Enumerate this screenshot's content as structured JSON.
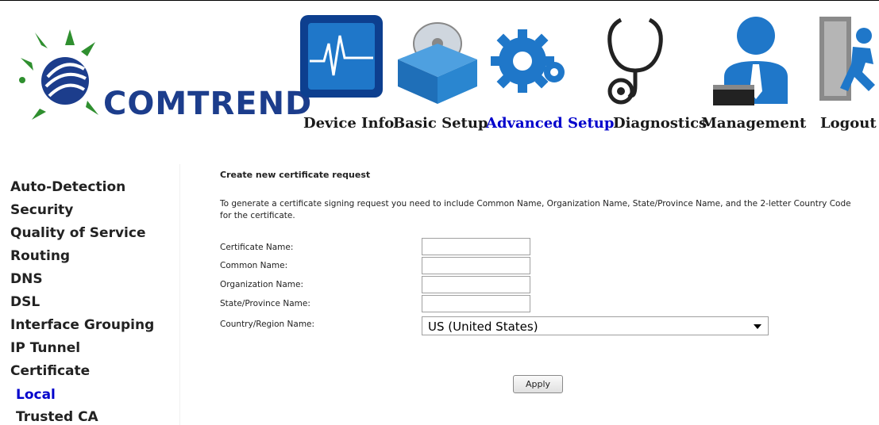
{
  "brand": {
    "logo_text": "COMTREND"
  },
  "nav": {
    "items": [
      {
        "label": "Device Info",
        "icon": "monitor-chart-icon"
      },
      {
        "label": "Basic Setup",
        "icon": "disc-box-icon"
      },
      {
        "label": "Advanced Setup",
        "icon": "gears-icon",
        "active": true
      },
      {
        "label": "Diagnostics",
        "icon": "stethoscope-icon"
      },
      {
        "label": "Management",
        "icon": "user-admin-icon"
      },
      {
        "label": "Logout",
        "icon": "exit-runner-icon"
      }
    ]
  },
  "sidebar": {
    "items": [
      {
        "label": "Auto-Detection"
      },
      {
        "label": "Security"
      },
      {
        "label": "Quality of Service"
      },
      {
        "label": "Routing"
      },
      {
        "label": "DNS"
      },
      {
        "label": "DSL"
      },
      {
        "label": "Interface Grouping"
      },
      {
        "label": "IP Tunnel"
      },
      {
        "label": "Certificate"
      },
      {
        "label": "Local",
        "active": true
      },
      {
        "label": "Trusted CA"
      }
    ]
  },
  "form": {
    "title": "Create new certificate request",
    "description": "To generate a certificate signing request you need to include Common Name, Organization Name, State/Province Name, and the 2-letter Country Code for the certificate.",
    "fields": [
      {
        "label": "Certificate Name:",
        "value": ""
      },
      {
        "label": "Common Name:",
        "value": ""
      },
      {
        "label": "Organization Name:",
        "value": ""
      },
      {
        "label": "State/Province Name:",
        "value": ""
      }
    ],
    "country": {
      "label": "Country/Region Name:",
      "value": "US (United States)"
    },
    "apply_label": "Apply"
  },
  "colors": {
    "brand_blue": "#1c3d8c",
    "active_link": "#0000cc",
    "icon_blue": "#1f77c9"
  }
}
